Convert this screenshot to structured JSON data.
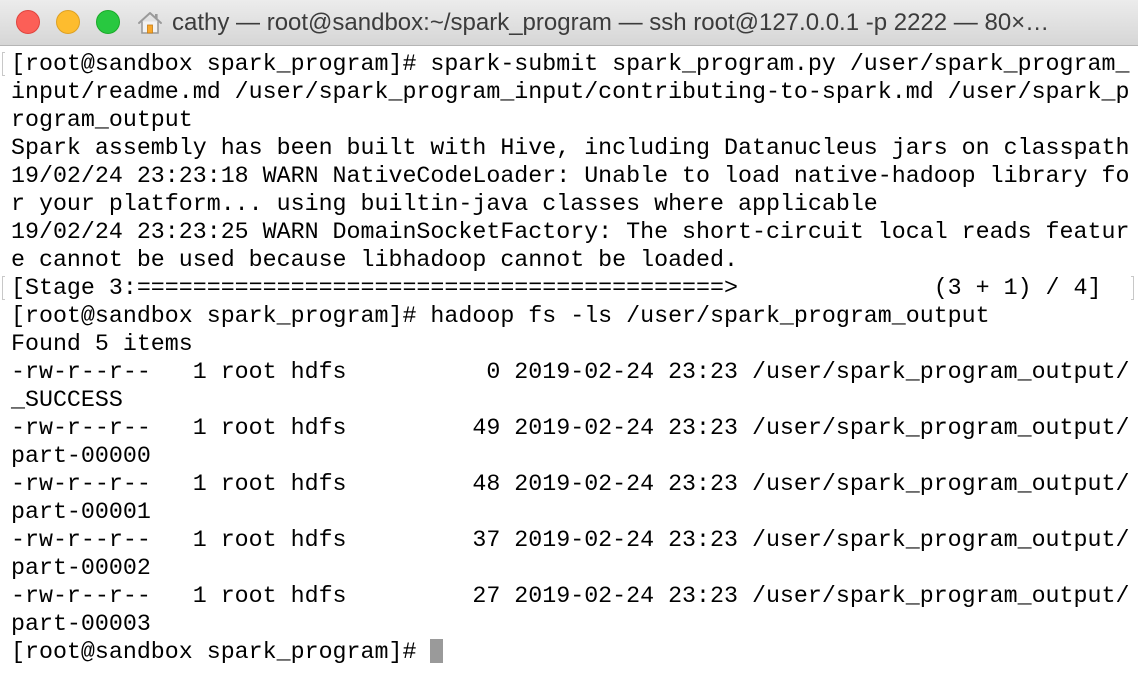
{
  "window": {
    "title": "cathy — root@sandbox:~/spark_program — ssh root@127.0.0.1 -p 2222 — 80×…",
    "icons": {
      "close": "close-icon",
      "minimize": "minimize-icon",
      "zoom": "zoom-icon",
      "home": "home-folder-icon"
    },
    "colors": {
      "close": "#fc5f57",
      "minimize": "#fdbc2e",
      "zoom": "#28c840",
      "background": "#ffffff",
      "text": "#000000",
      "cursor": "#9a9a9a"
    }
  },
  "terminal": {
    "lines": [
      "[root@sandbox spark_program]# spark-submit spark_program.py /user/spark_program_",
      "input/readme.md /user/spark_program_input/contributing-to-spark.md /user/spark_p",
      "rogram_output",
      "Spark assembly has been built with Hive, including Datanucleus jars on classpath",
      "19/02/24 23:23:18 WARN NativeCodeLoader: Unable to load native-hadoop library fo",
      "r your platform... using builtin-java classes where applicable",
      "19/02/24 23:23:25 WARN DomainSocketFactory: The short-circuit local reads featur",
      "e cannot be used because libhadoop cannot be loaded.",
      "[Stage 3:==========================================>              (3 + 1) / 4]",
      "[root@sandbox spark_program]# hadoop fs -ls /user/spark_program_output",
      "Found 5 items",
      "-rw-r--r--   1 root hdfs          0 2019-02-24 23:23 /user/spark_program_output/",
      "_SUCCESS",
      "-rw-r--r--   1 root hdfs         49 2019-02-24 23:23 /user/spark_program_output/",
      "part-00000",
      "-rw-r--r--   1 root hdfs         48 2019-02-24 23:23 /user/spark_program_output/",
      "part-00001",
      "-rw-r--r--   1 root hdfs         37 2019-02-24 23:23 /user/spark_program_output/",
      "part-00002",
      "-rw-r--r--   1 root hdfs         27 2019-02-24 23:23 /user/spark_program_output/",
      "part-00003"
    ],
    "prompt": "[root@sandbox spark_program]# "
  }
}
